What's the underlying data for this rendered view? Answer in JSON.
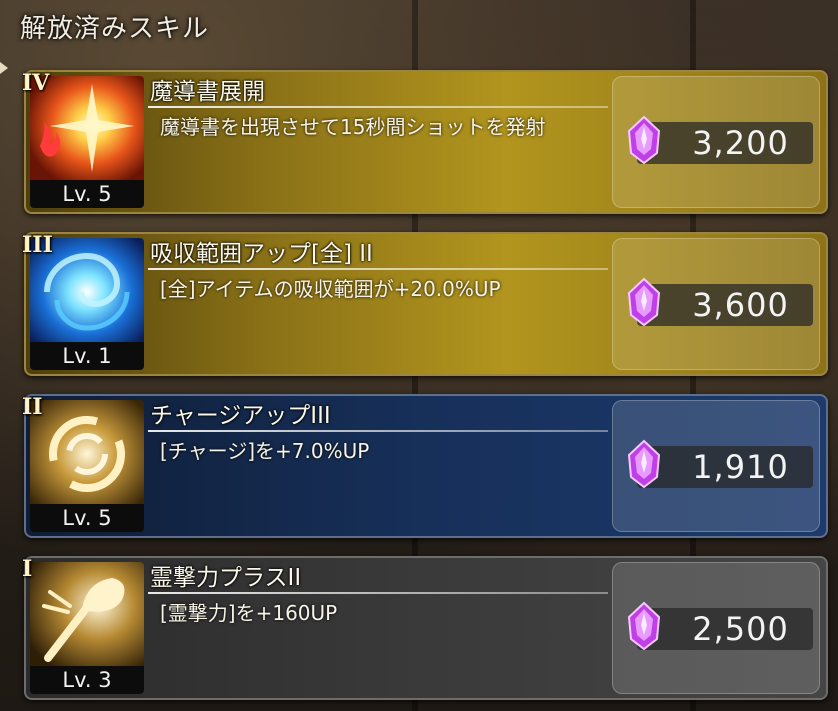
{
  "screen_title": "解放済みスキル",
  "skills": [
    {
      "rank": "IV",
      "level": "Lv. 5",
      "name": "魔導書展開",
      "description": "魔導書を出現させて15秒間ショットを発射",
      "price": "3,200",
      "icon": "fire-burst-icon",
      "style": "gold"
    },
    {
      "rank": "III",
      "level": "Lv. 1",
      "name": "吸収範囲アップ[全] II",
      "description": "[全]アイテムの吸収範囲が+20.0%UP",
      "price": "3,600",
      "icon": "blue-vortex-icon",
      "style": "gold"
    },
    {
      "rank": "II",
      "level": "Lv. 5",
      "name": "チャージアップIII",
      "description": "[チャージ]を+7.0%UP",
      "price": "1,910",
      "icon": "charge-swirl-icon",
      "style": "blue"
    },
    {
      "rank": "I",
      "level": "Lv. 3",
      "name": "霊撃力プラスII",
      "description": "[霊撃力]を+160UP",
      "price": "2,500",
      "icon": "spirit-strike-icon",
      "style": "gray"
    }
  ],
  "colors": {
    "gem": "#d45cff",
    "gold_card": "#b2951e",
    "blue_card": "#1c3a6b",
    "gray_card": "#3a3a3a"
  }
}
